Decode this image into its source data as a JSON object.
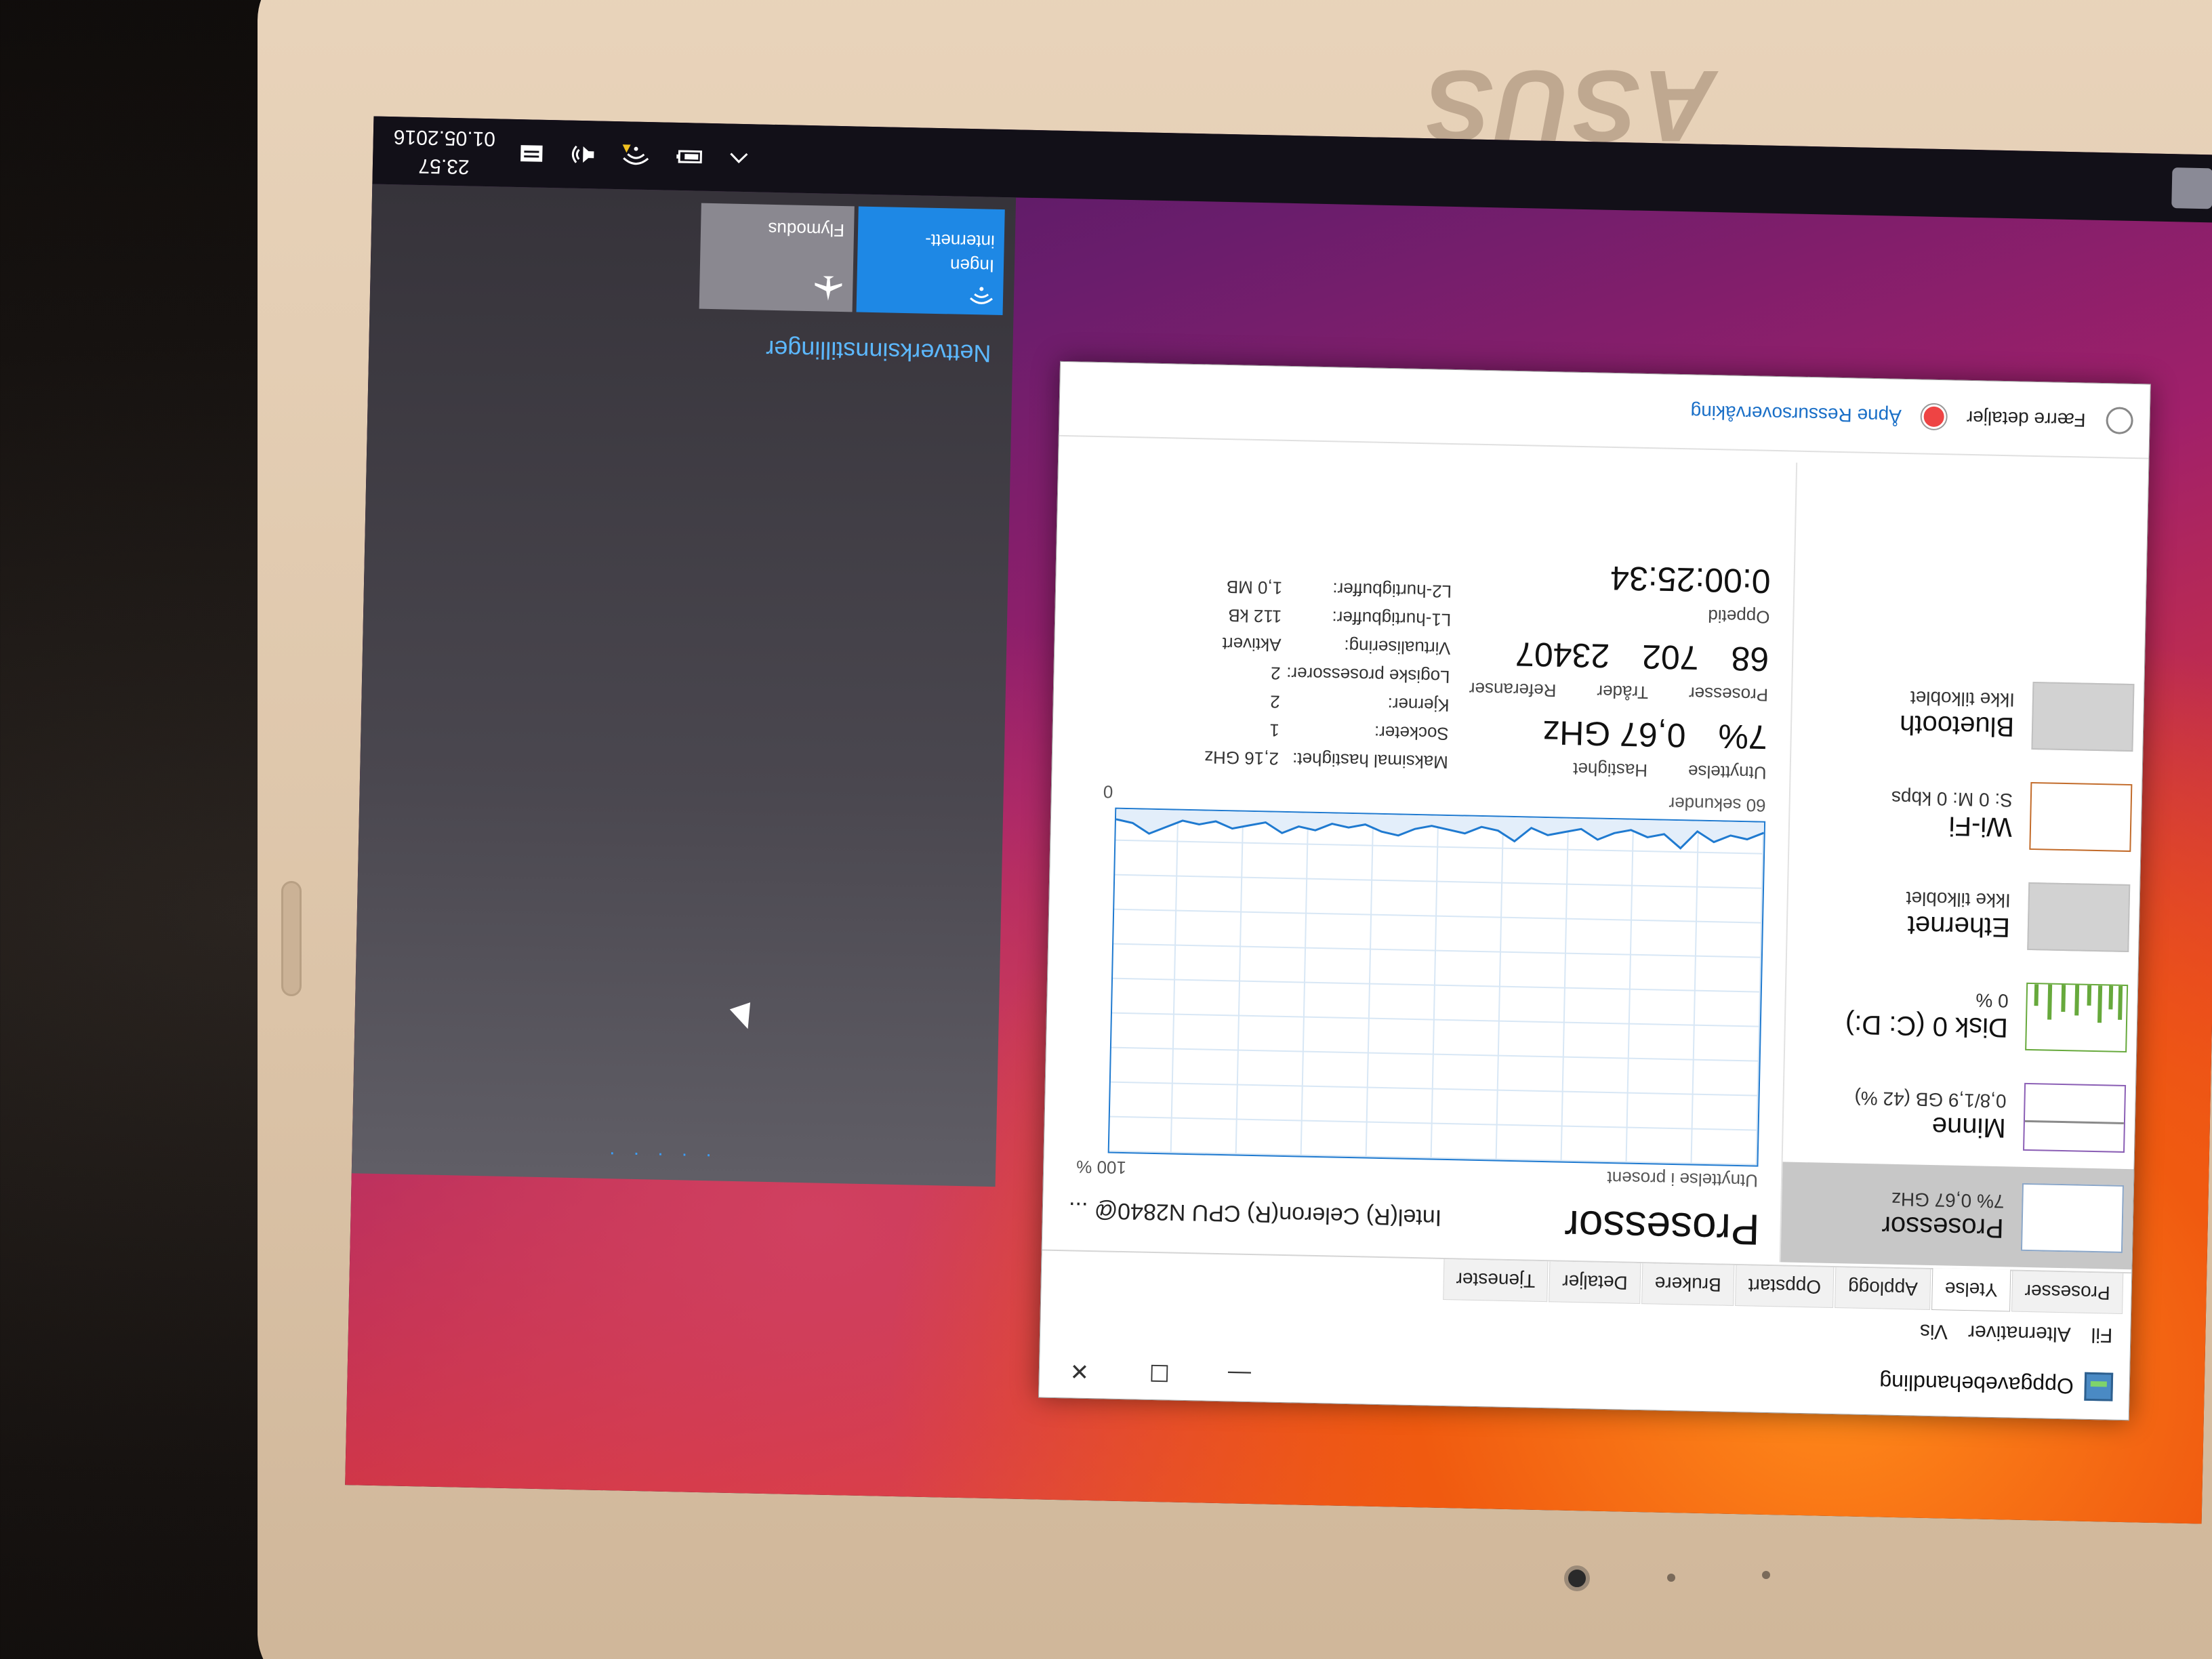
{
  "bezel": {
    "brand": "ASUS"
  },
  "taskbar": {
    "time": "23.57",
    "date": "01.05.2016"
  },
  "network_flyout": {
    "settings_link": "Nettverksinnstillinger",
    "wifi_tile_line1": "Ingen",
    "wifi_tile_line2": "internett-",
    "airplane_tile_label": "Flymodus",
    "dots": ". . . . ."
  },
  "task_manager": {
    "title": "Oppgavebehandling",
    "menu": [
      "Fil",
      "Alternativer",
      "Vis"
    ],
    "tabs": [
      "Prosesser",
      "Ytelse",
      "Applogg",
      "Oppstart",
      "Brukere",
      "Detaljer",
      "Tjenester"
    ],
    "active_tab": "Ytelse",
    "sidebar": [
      {
        "name": "Prosessor",
        "sub": "7% 0,67 GHz"
      },
      {
        "name": "Minne",
        "sub": "0,8/1,9 GB (42 %)"
      },
      {
        "name": "Disk 0 (C: D:)",
        "sub": "0 %"
      },
      {
        "name": "Ethernet",
        "sub": "Ikke tilkoblet"
      },
      {
        "name": "Wi-Fi",
        "sub": "S: 0 M: 0 kbps"
      },
      {
        "name": "Bluetooth",
        "sub": "Ikke tilkoblet"
      }
    ],
    "header": {
      "title": "Prosessor",
      "model": "Intel(R) Celeron(R) CPU N2840@ ..."
    },
    "graph": {
      "util_label": "Utnyttelse i prosent",
      "max_label": "100 %",
      "time_label": "60 sekunder",
      "min_label": "0",
      "cpu_history": [
        3,
        5,
        4,
        6,
        3,
        8,
        4,
        5,
        3,
        4,
        6,
        3,
        4,
        5,
        3,
        7,
        4,
        3,
        5,
        4,
        3,
        4,
        6,
        5,
        3,
        4,
        3,
        5,
        4,
        6,
        3,
        4,
        5,
        3,
        4,
        3,
        5,
        7,
        4,
        3
      ]
    },
    "stats": {
      "labels1": [
        "Utnyttelse",
        "Hastighet"
      ],
      "utilization": "7%",
      "speed": "0,67 GHz",
      "labels2": [
        "Prosesser",
        "Tråder",
        "Referanser"
      ],
      "processes": "68",
      "threads": "702",
      "handles": "23407",
      "uptime_label": "Oppetid",
      "uptime": "0:00:25:34"
    },
    "details": [
      {
        "k": "Maksimal hastighet:",
        "v": "2,16 GHz"
      },
      {
        "k": "Socketer:",
        "v": "1"
      },
      {
        "k": "Kjerner:",
        "v": "2"
      },
      {
        "k": "Logiske prosessorer:",
        "v": "2"
      },
      {
        "k": "Virtualisering:",
        "v": "Aktivert"
      },
      {
        "k": "L1-hurtigbuffer:",
        "v": "112 kB"
      },
      {
        "k": "L2-hurtigbuffer:",
        "v": "1,0 MB"
      }
    ],
    "footer": {
      "fewer_details": "Færre detaljer",
      "resource_monitor": "Åpne Ressursovervåking"
    },
    "accent_color": "#1f7ad0"
  }
}
